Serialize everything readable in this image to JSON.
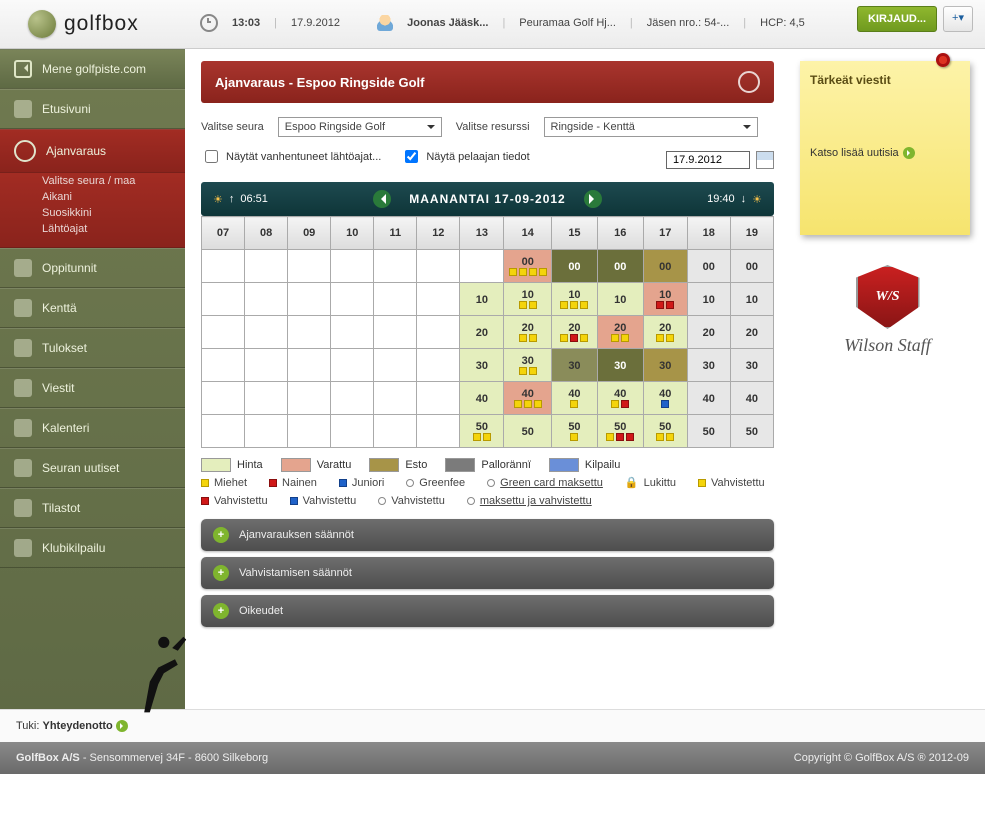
{
  "header": {
    "brand": "golfbox",
    "time": "13:03",
    "date": "17.9.2012",
    "user": "Joonas Jääsk...",
    "club": "Peuramaa Golf Hj...",
    "memberLabel": "Jäsen nro.: 54-...",
    "hcpLabel": "HCP: 4,5",
    "loginBtn": "KIRJAUD...",
    "flagBtn": "+▾"
  },
  "sidebar": {
    "back": "Mene golfpiste.com",
    "items": [
      {
        "label": "Etusivuni"
      },
      {
        "label": "Ajanvaraus",
        "active": true,
        "subs": [
          "Valitse seura / maa",
          "Aikani",
          "Suosikkini",
          "Lähtöajat"
        ]
      },
      {
        "label": "Oppitunnit"
      },
      {
        "label": "Kenttä"
      },
      {
        "label": "Tulokset"
      },
      {
        "label": "Viestit"
      },
      {
        "label": "Kalenteri"
      },
      {
        "label": "Seuran uutiset"
      },
      {
        "label": "Tilastot"
      },
      {
        "label": "Klubikilpailu"
      }
    ]
  },
  "main": {
    "title": "Ajanvaraus - Espoo Ringside Golf",
    "selClubLabel": "Valitse seura",
    "selClubValue": "Espoo Ringside Golf",
    "selResLabel": "Valitse resurssi",
    "selResValue": "Ringside - Kenttä",
    "chkOld": "Näytät vanhentuneet lähtöajat...",
    "chkPlayer": "Näytä pelaajan tiedot",
    "dateValue": "17.9.2012",
    "day": {
      "sunrise": "06:51",
      "title": "MAANANTAI 17-09-2012",
      "sunset": "19:40"
    },
    "hours": [
      "07",
      "08",
      "09",
      "10",
      "11",
      "12",
      "13",
      "14",
      "15",
      "16",
      "17",
      "18",
      "19"
    ],
    "rows": [
      {
        "min": "00",
        "cells": [
          null,
          null,
          null,
          null,
          null,
          null,
          null,
          {
            "bg": "bg-res",
            "dots": [
              "y",
              "y",
              "y",
              "y"
            ]
          },
          {
            "bg": "bg-dark"
          },
          {
            "bg": "bg-dark"
          },
          {
            "bg": "bg-block"
          },
          {},
          {}
        ]
      },
      {
        "min": "10",
        "cells": [
          null,
          null,
          null,
          null,
          null,
          null,
          {
            "bg": "bg-price"
          },
          {
            "bg": "bg-price",
            "dots": [
              "y",
              "y"
            ]
          },
          {
            "bg": "bg-price",
            "dots": [
              "y",
              "y",
              "y"
            ]
          },
          {
            "bg": "bg-price"
          },
          {
            "bg": "bg-res",
            "dots": [
              "r",
              "r"
            ]
          },
          {},
          {}
        ]
      },
      {
        "min": "20",
        "cells": [
          null,
          null,
          null,
          null,
          null,
          null,
          {
            "bg": "bg-price"
          },
          {
            "bg": "bg-price",
            "dots": [
              "y",
              "y"
            ]
          },
          {
            "bg": "bg-price",
            "dots": [
              "y",
              "r",
              "y"
            ]
          },
          {
            "bg": "bg-res",
            "dots": [
              "y",
              "y"
            ]
          },
          {
            "bg": "bg-price",
            "dots": [
              "y",
              "y"
            ]
          },
          {},
          {}
        ]
      },
      {
        "min": "30",
        "cells": [
          null,
          null,
          null,
          null,
          null,
          null,
          {
            "bg": "bg-price"
          },
          {
            "bg": "bg-price",
            "dots": [
              "y",
              "y"
            ]
          },
          {
            "bg": "bg-dark2"
          },
          {
            "bg": "bg-dark"
          },
          {
            "bg": "bg-block"
          },
          {},
          {}
        ]
      },
      {
        "min": "40",
        "cells": [
          null,
          null,
          null,
          null,
          null,
          null,
          {
            "bg": "bg-price"
          },
          {
            "bg": "bg-res",
            "dots": [
              "y",
              "y",
              "y"
            ]
          },
          {
            "bg": "bg-price",
            "dots": [
              "y"
            ]
          },
          {
            "bg": "bg-price",
            "dots": [
              "y",
              "r"
            ]
          },
          {
            "bg": "bg-price",
            "dots": [
              "b"
            ]
          },
          {},
          {}
        ]
      },
      {
        "min": "50",
        "cells": [
          null,
          null,
          null,
          null,
          null,
          null,
          {
            "bg": "bg-price",
            "dots": [
              "y",
              "y"
            ]
          },
          {
            "bg": "bg-price"
          },
          {
            "bg": "bg-price",
            "dots": [
              "y"
            ]
          },
          {
            "bg": "bg-price",
            "dots": [
              "y",
              "r",
              "r"
            ]
          },
          {
            "bg": "bg-price",
            "dots": [
              "y",
              "y"
            ]
          },
          {},
          {}
        ]
      }
    ],
    "legend1": [
      {
        "cls": "bg-price",
        "label": "Hinta"
      },
      {
        "cls": "bg-res",
        "label": "Varattu"
      },
      {
        "cls": "bg-block",
        "label": "Esto"
      },
      {
        "cls": "bg-thunder",
        "label": "Pallorännï"
      },
      {
        "cls": "",
        "label": "Kilpailu",
        "sw": "#6a8fd8"
      }
    ],
    "legend2": [
      {
        "d": "y",
        "label": "Miehet"
      },
      {
        "d": "r",
        "label": "Nainen"
      },
      {
        "d": "b",
        "label": "Juniori"
      },
      {
        "d": "c",
        "label": "Greenfee"
      },
      {
        "d": "c",
        "label": "Green card maksettu",
        "under": true
      },
      {
        "lock": true,
        "label": "Lukittu"
      },
      {
        "d": "y",
        "fill": true,
        "label": "Vahvistettu"
      },
      {
        "d": "r",
        "fill": true,
        "label": "Vahvistettu"
      },
      {
        "d": "b",
        "fill": true,
        "label": "Vahvistettu"
      },
      {
        "d": "c",
        "fill": true,
        "label": "Vahvistettu"
      },
      {
        "d": "c",
        "fill": true,
        "label": "maksettu ja vahvistettu",
        "under": true
      }
    ],
    "accordions": [
      "Ajanvarauksen säännöt",
      "Vahvistamisen säännöt",
      "Oikeudet"
    ]
  },
  "right": {
    "stickyTitle": "Tärkeät viestit",
    "stickyLink": "Katso lisää uutisia",
    "sponsor": "Wilson Staff",
    "shield": "W/S"
  },
  "support": {
    "label": "Tuki:",
    "link": "Yhteydenotto"
  },
  "footer": {
    "left": "GolfBox A/S - Sensommervej 34F - 8600 Silkeborg",
    "right": "Copyright © GolfBox A/S ® 2012-09"
  }
}
